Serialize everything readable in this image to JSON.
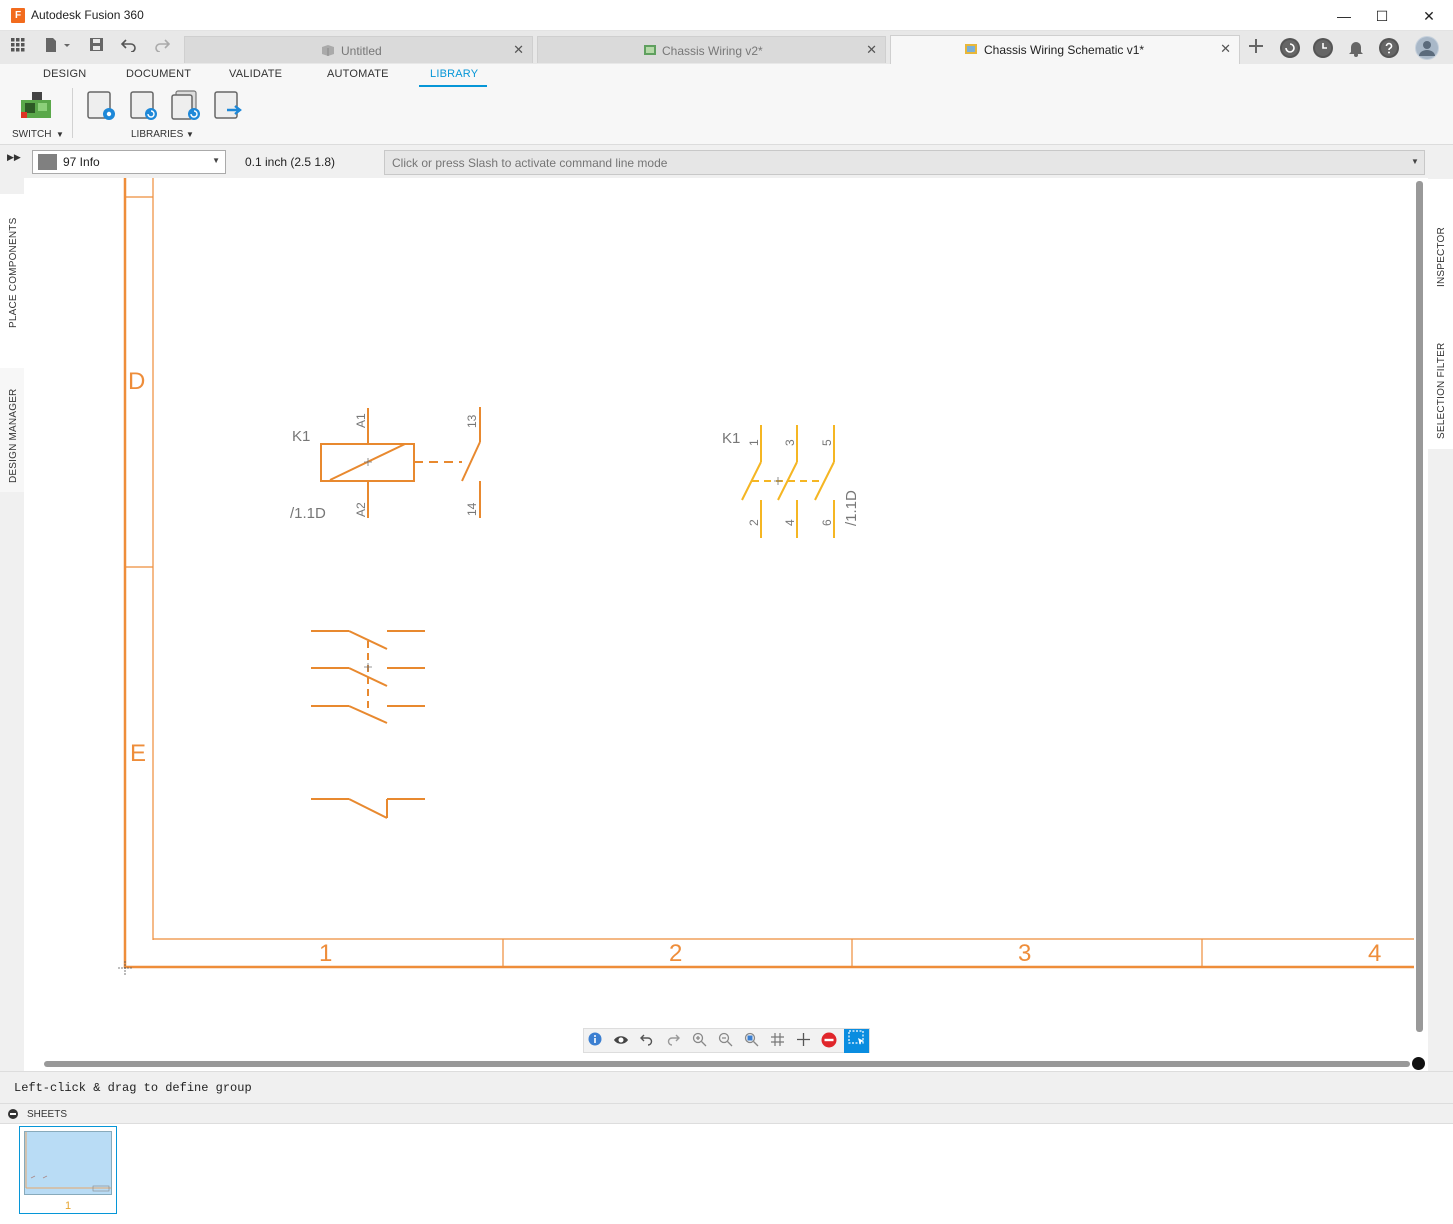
{
  "window": {
    "title": "Autodesk Fusion 360",
    "logo_letter": "F",
    "minimize_glyph": "—",
    "maximize_glyph": "☐",
    "close_glyph": "✕"
  },
  "doc_tabs": [
    {
      "label": "Untitled",
      "icon": "box-icon",
      "active": false,
      "close": "✕"
    },
    {
      "label": "Chassis Wiring v2*",
      "icon": "board-icon",
      "active": false,
      "close": "✕"
    },
    {
      "label": "Chassis Wiring Schematic v1*",
      "icon": "schematic-icon",
      "active": true,
      "close": "✕"
    }
  ],
  "ribbon": {
    "tabs": [
      "DESIGN",
      "DOCUMENT",
      "VALIDATE",
      "AUTOMATE",
      "LIBRARY"
    ],
    "active_tab": "LIBRARY",
    "groups": {
      "switch": "SWITCH",
      "libraries": "LIBRARIES"
    }
  },
  "command_bar": {
    "layer": "97 Info",
    "grid": "0.1 inch (2.5 1.8)",
    "placeholder": "Click or press Slash to activate command line mode"
  },
  "left_panel": [
    "PLACE COMPONENTS",
    "DESIGN MANAGER"
  ],
  "right_panel": [
    "INSPECTOR",
    "SELECTION FILTER"
  ],
  "schematic": {
    "frame_rows": [
      "D",
      "E"
    ],
    "frame_cols": [
      "1",
      "2",
      "3",
      "4"
    ],
    "relay_coil": {
      "name": "K1",
      "pin_top": "A1",
      "pin_bottom": "A2",
      "xref": "/1.1D"
    },
    "contact": {
      "pin_top": "13",
      "pin_bottom": "14"
    },
    "three_pole": {
      "name": "K1",
      "pins_top": [
        "1",
        "3",
        "5"
      ],
      "pins_bottom": [
        "2",
        "4",
        "6"
      ],
      "xref": "/1.1D"
    },
    "colors": {
      "frame": "#ee8d3a",
      "symbol": "#e8892f",
      "highlight": "#f5b623",
      "text": "#777777"
    }
  },
  "nav_bar_icons": [
    "info-icon",
    "eye-icon",
    "undo-icon",
    "redo-icon",
    "zoom-in-icon",
    "zoom-out-icon",
    "zoom-fit-icon",
    "grid-icon",
    "crosshair-icon",
    "stop-icon",
    "select-icon"
  ],
  "status": {
    "message": "Left-click & drag to define group"
  },
  "sheets": {
    "label": "SHEETS",
    "items": [
      "1"
    ]
  }
}
